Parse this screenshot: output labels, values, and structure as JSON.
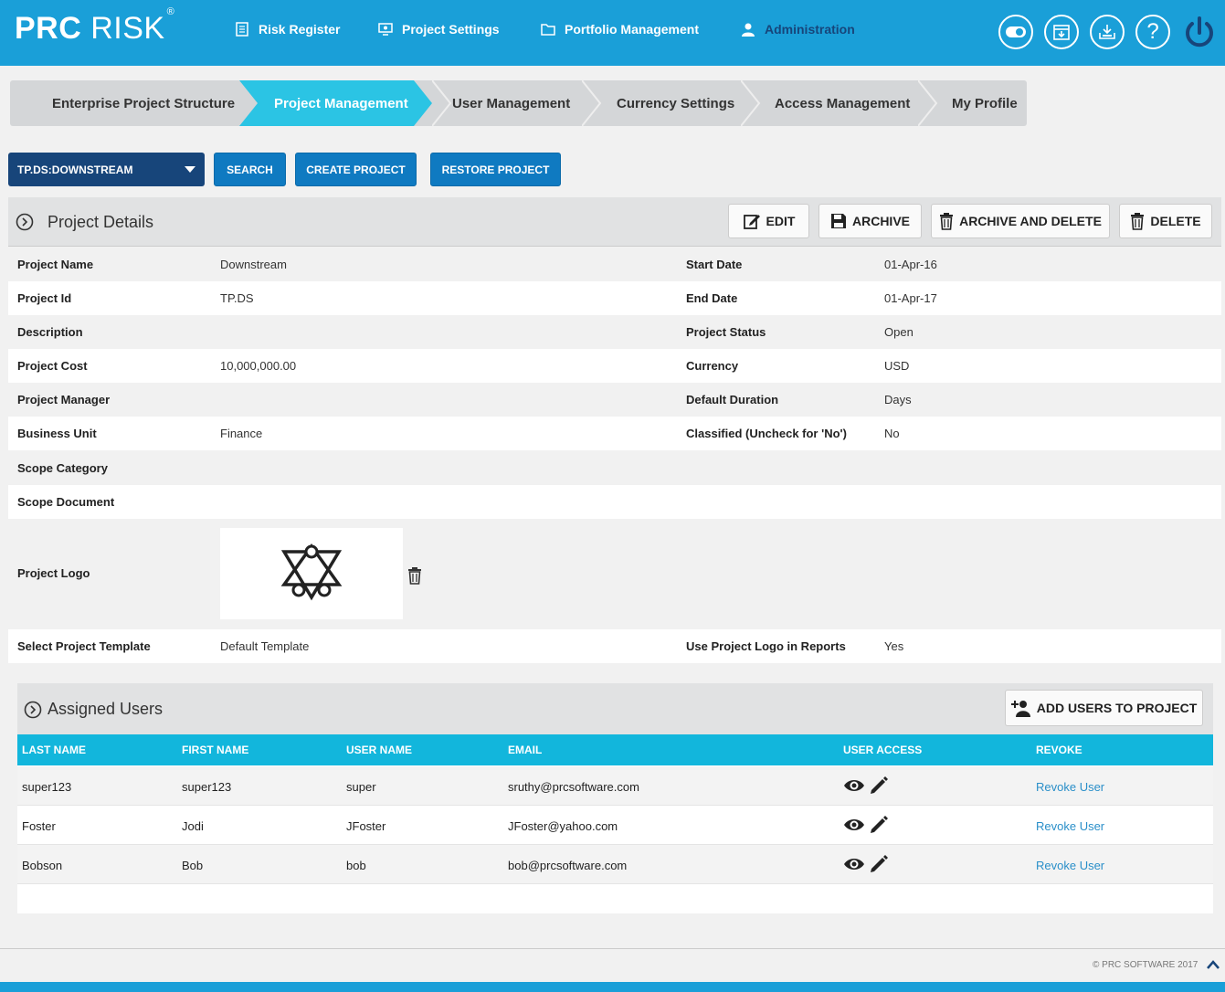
{
  "header": {
    "logo_prc": "PRC",
    "logo_risk": "RISK",
    "logo_reg": "®",
    "nav": [
      {
        "label": "Risk Register"
      },
      {
        "label": "Project Settings"
      },
      {
        "label": "Portfolio Management"
      },
      {
        "label": "Administration"
      }
    ],
    "accent_color": "#1a9fd8",
    "active_nav_color": "#17457a"
  },
  "breadcrumb": [
    {
      "label": "Enterprise Project Structure"
    },
    {
      "label": "Project Management"
    },
    {
      "label": "User Management"
    },
    {
      "label": "Currency Settings"
    },
    {
      "label": "Access Management"
    },
    {
      "label": "My Profile"
    }
  ],
  "toolbar": {
    "project_select_value": "TP.DS:DOWNSTREAM",
    "search_label": "SEARCH",
    "create_label": "CREATE PROJECT",
    "restore_label": "RESTORE PROJECT"
  },
  "project_details": {
    "title": "Project Details",
    "edit_label": "EDIT",
    "archive_label": "ARCHIVE",
    "archive_delete_label": "ARCHIVE AND DELETE",
    "delete_label": "DELETE",
    "fields": {
      "name_label": "Project Name",
      "name_value": "Downstream",
      "start_label": "Start Date",
      "start_value": "01-Apr-16",
      "id_label": "Project Id",
      "id_value": "TP.DS",
      "end_label": "End Date",
      "end_value": "01-Apr-17",
      "desc_label": "Description",
      "status_label": "Project Status",
      "status_value": "Open",
      "cost_label": "Project Cost",
      "cost_value": "10,000,000.00",
      "currency_label": "Currency",
      "currency_value": "USD",
      "manager_label": "Project Manager",
      "duration_label": "Default Duration",
      "duration_value": "Days",
      "bu_label": "Business Unit",
      "bu_value": "Finance",
      "classified_label": "Classified (Uncheck for 'No')",
      "classified_value": "No",
      "scope_cat_label": "Scope Category",
      "scope_doc_label": "Scope Document",
      "logo_label": "Project Logo",
      "template_label": "Select Project Template",
      "template_value": "Default Template",
      "use_logo_label": "Use Project Logo in Reports",
      "use_logo_value": "Yes"
    }
  },
  "assigned_users": {
    "title": "Assigned Users",
    "add_label": "ADD USERS TO PROJECT",
    "columns": [
      "LAST NAME",
      "FIRST NAME",
      "USER NAME",
      "EMAIL",
      "USER ACCESS",
      "REVOKE"
    ],
    "rows": [
      {
        "last": "super123",
        "first": "super123",
        "user": "super",
        "email": "sruthy@prcsoftware.com",
        "revoke": "Revoke User"
      },
      {
        "last": "Foster",
        "first": "Jodi",
        "user": "JFoster",
        "email": "JFoster@yahoo.com",
        "revoke": "Revoke User"
      },
      {
        "last": "Bobson",
        "first": "Bob",
        "user": "bob",
        "email": "bob@prcsoftware.com",
        "revoke": "Revoke User"
      }
    ]
  },
  "footer": {
    "copyright": "© PRC SOFTWARE 2017"
  }
}
